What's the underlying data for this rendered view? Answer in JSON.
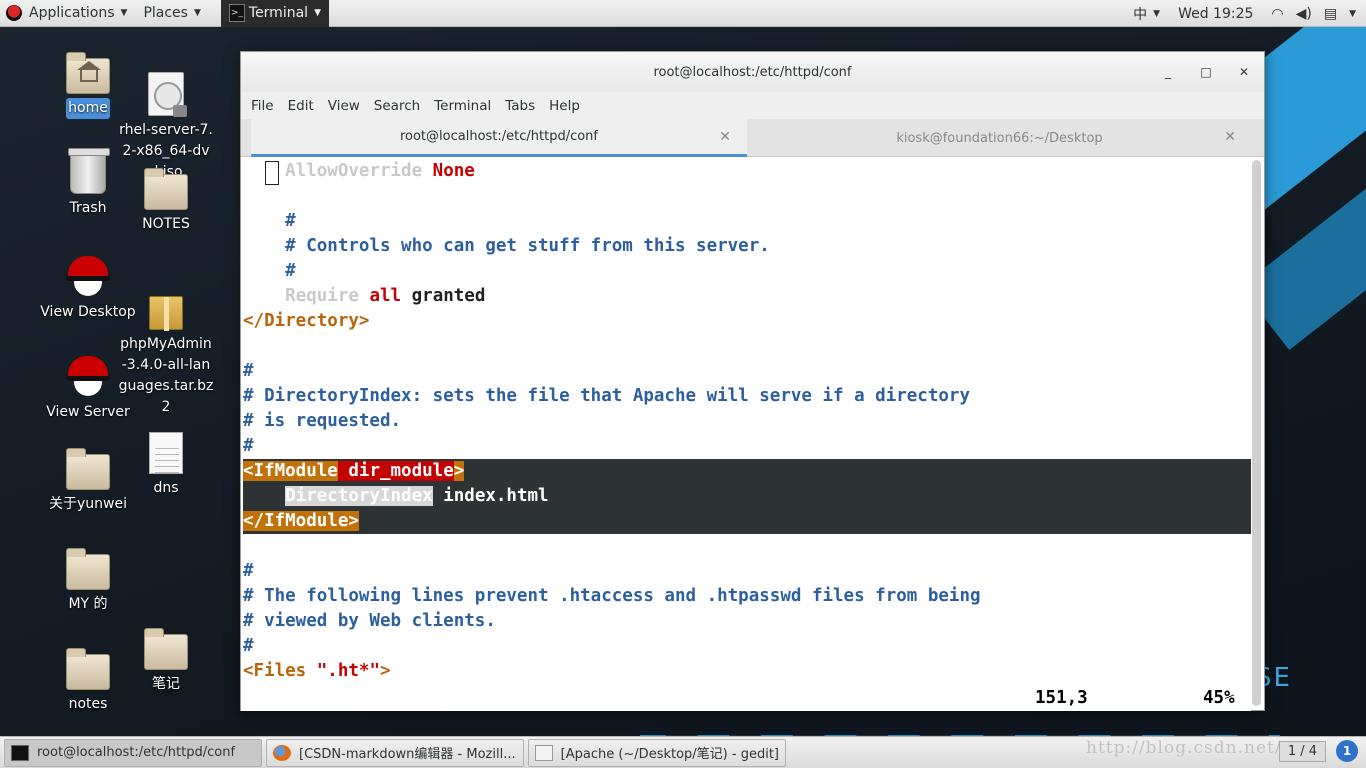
{
  "top_bar": {
    "applications_label": "Applications",
    "places_label": "Places",
    "terminal_label": "Terminal",
    "input_method": "中",
    "clock": "Wed 19:25"
  },
  "desktop": {
    "brand_text": "SE",
    "icons": {
      "home": "home",
      "rhel_iso": "rhel-server-7.2-x86_64-dvd.iso",
      "trash": "Trash",
      "notes_upper": "NOTES",
      "view_desktop": "View Desktop",
      "phpmyadmin": "phpMyAdmin-3.4.0-all-languages.tar.bz2",
      "view_server": "View Server",
      "dns": "dns",
      "yunwei": "关于yunwei",
      "my": "MY 的",
      "biji": "笔记",
      "notes_lower": "notes"
    }
  },
  "terminal": {
    "title": "root@localhost:/etc/httpd/conf",
    "menu": [
      "File",
      "Edit",
      "View",
      "Search",
      "Terminal",
      "Tabs",
      "Help"
    ],
    "tabs": [
      {
        "label": "root@localhost:/etc/httpd/conf",
        "active": true
      },
      {
        "label": "kiosk@foundation66:~/Desktop",
        "active": false
      }
    ],
    "lines": {
      "l1_a": "AllowOverride",
      "l1_b": "None",
      "l3": "#",
      "l4": "# Controls who can get stuff from this server.",
      "l5": "#",
      "l6_a": "Require",
      "l6_b": "all",
      "l6_c": "granted",
      "l7": "</Directory>",
      "l9": "#",
      "l10": "# DirectoryIndex: sets the file that Apache will serve if a directory",
      "l11": "# is requested.",
      "l12": "#",
      "l13_a": "<IfModule",
      "l13_b": "dir_module",
      "l13_c": ">",
      "l14_a": "DirectoryIndex",
      "l14_b": "index.html",
      "l15": "</IfModule>",
      "l17": "#",
      "l18": "# The following lines prevent .htaccess and .htpasswd files from being",
      "l19": "# viewed by Web clients.",
      "l20": "#",
      "l21_a": "<Files",
      "l21_b": "\".ht*\"",
      "l21_c": ">"
    },
    "status": {
      "position": "151,3",
      "percent": "45%"
    }
  },
  "taskbar": {
    "tasks": [
      {
        "label": "root@localhost:/etc/httpd/conf"
      },
      {
        "label": "[CSDN-markdown编辑器 - Mozill..."
      },
      {
        "label": "[Apache (~/Desktop/笔记) - gedit]"
      }
    ],
    "workspace": "1 / 4",
    "watermark": "http://blog.csdn.net/"
  },
  "colors": {
    "comment": "#2c5f9e",
    "keyword": "#b8640a",
    "value_red": "#c40000",
    "highlight_bg": "#2e3436",
    "tab_accent": "#4a90d9"
  }
}
